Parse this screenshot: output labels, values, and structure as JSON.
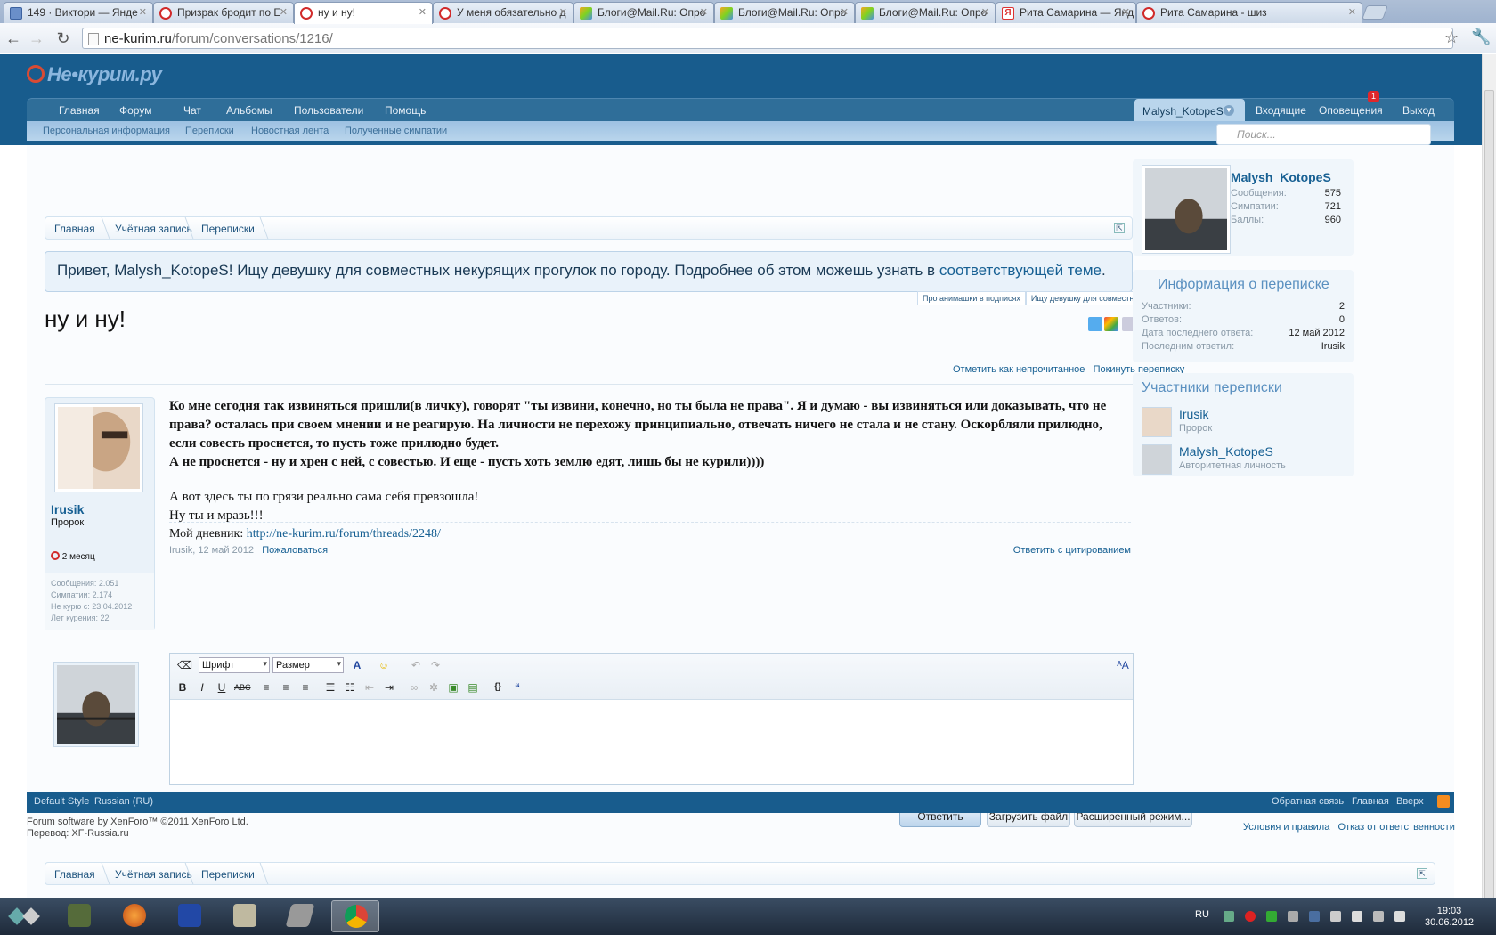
{
  "browser": {
    "tabs": [
      {
        "title": "149 · Виктори — Янде",
        "icon": "mail-icon",
        "left": 0
      },
      {
        "title": "Призрак бродит по Е",
        "icon": "ban-icon"
      },
      {
        "title": "ну и ну!",
        "icon": "ban-icon",
        "active": true
      },
      {
        "title": "У меня обязательно д",
        "icon": "ban-icon"
      },
      {
        "title": "Блоги@Mail.Ru: Опро",
        "icon": "blog-icon"
      },
      {
        "title": "Блоги@Mail.Ru: Опро",
        "icon": "blog-icon"
      },
      {
        "title": "Блоги@Mail.Ru: Опро",
        "icon": "blog-icon"
      },
      {
        "title": "Рита Самарина — Янд",
        "icon": "yandex-icon"
      },
      {
        "title": "Рита Самарина - шиз",
        "icon": "ban-icon"
      }
    ],
    "url_domain": "ne-kurim.ru",
    "url_path": "/forum/conversations/1216/"
  },
  "site": {
    "logo": "Не•курим.ру",
    "nav": [
      "Главная",
      "Форум",
      "Чат",
      "Альбомы",
      "Пользователи",
      "Помощь"
    ],
    "username": "Malysh_KotopeS",
    "user_links": [
      "Входящие",
      "Оповещения",
      "Выход"
    ],
    "notifications_count": "1",
    "subnav": [
      "Персональная информация",
      "Переписки",
      "Новостная лента",
      "Полученные симпатии"
    ],
    "search_placeholder": "Поиск..."
  },
  "breadcrumb": [
    "Главная",
    "Учётная запись",
    "Переписки"
  ],
  "notice": {
    "text": "Привет, Malysh_KotopeS! Ищу девушку для совместных некурящих прогулок по городу. Подробнее об этом можешь узнать в ",
    "link": "соответствующей теме",
    "end": ".",
    "tabs": [
      "Про анимашки в подписях",
      "Ищу девушку для совместных прогулок"
    ]
  },
  "conversation": {
    "title": "ну и ну!",
    "share_count": "0",
    "actions": [
      "Отметить как непрочитанное",
      "Покинуть переписку"
    ]
  },
  "post": {
    "author": "Irusik",
    "rank": "Пророк",
    "status": "2 месяц",
    "stats": [
      "Сообщения: 2.051",
      "Симпатии: 2.174",
      "Не курю с: 23.04.2012",
      "Лет курения: 22"
    ],
    "bold_lines": [
      "Ко мне сегодня так извиняться пришли(в личку), говорят \"ты извини, конечно, но ты была не права\". Я и думаю - вы извиняться или доказывать, что не права? осталась при своем мнении и не реагирую. На личности не перехожу принципиально, отвечать ничего не стала и не стану. Оскорбляли прилюдно, если совесть проснется, то пусть тоже прилюдно будет.",
      "А не проснется - ну и хрен с ней, с совестью. И еще - пусть хоть землю едят, лишь бы не курили))))"
    ],
    "plain_lines": [
      "А вот здесь ты по грязи реально сама себя превзошла!",
      "Ну ты и мразь!!!"
    ],
    "signature_label": "Мой дневник: ",
    "signature_link": "http://ne-kurim.ru/forum/threads/2248/",
    "meta": "Irusik, 12 май 2012",
    "report": "Пожаловаться",
    "quote": "Ответить с цитированием"
  },
  "editor": {
    "font_select": "Шрифт",
    "size_select": "Размер",
    "buttons": {
      "reply": "Ответить",
      "upload": "Загрузить файл",
      "advanced": "Расширенный режим..."
    }
  },
  "sidebar": {
    "user": {
      "name": "Malysh_KotopeS",
      "stats": [
        {
          "label": "Сообщения:",
          "value": "575"
        },
        {
          "label": "Симпатии:",
          "value": "721"
        },
        {
          "label": "Баллы:",
          "value": "960"
        }
      ]
    },
    "info_title": "Информация о переписке",
    "info": [
      {
        "label": "Участники:",
        "value": "2"
      },
      {
        "label": "Ответов:",
        "value": "0"
      },
      {
        "label": "Дата последнего ответа:",
        "value": "12 май 2012"
      },
      {
        "label": "Последним ответил:",
        "value": "Irusik"
      }
    ],
    "participants_title": "Участники переписки",
    "participants": [
      {
        "name": "Irusik",
        "rank": "Пророк"
      },
      {
        "name": "Malysh_KotopeS",
        "rank": "Авторитетная личность"
      }
    ]
  },
  "footer": {
    "left": [
      "Default Style",
      "Russian (RU)"
    ],
    "right": [
      "Обратная связь",
      "Главная",
      "Вверх"
    ],
    "copyright": "Forum software by XenForo™ ©2011 XenForo Ltd.",
    "translation": "Перевод: XF-Russia.ru",
    "links": [
      "Условия и правила",
      "Отказ от ответственности"
    ]
  },
  "taskbar": {
    "lang": "RU",
    "time": "19:03",
    "date": "30.06.2012"
  }
}
